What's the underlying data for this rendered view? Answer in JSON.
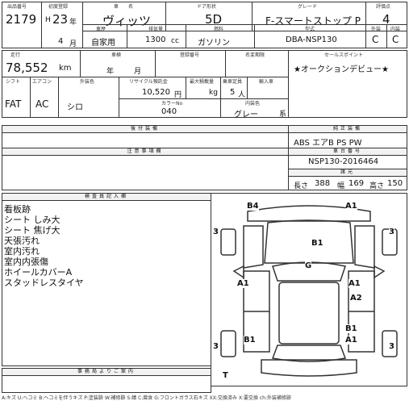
{
  "lot": {
    "header": "出品番号",
    "value": "2179"
  },
  "first_reg": {
    "header": "初度登録",
    "era": "H",
    "year": "23",
    "year_unit": "年",
    "month": "4",
    "month_unit": "月"
  },
  "car_name": {
    "header": "車　　名",
    "value": "ヴィッツ"
  },
  "door": {
    "header": "ドア形状",
    "value": "5D"
  },
  "grade": {
    "header": "グレード",
    "value": "F-スマートストップ P"
  },
  "score": {
    "header": "評価点",
    "value": "4"
  },
  "use": {
    "header": "車歴",
    "value": "自家用"
  },
  "displacement": {
    "header": "排気量",
    "value": "1300",
    "unit": "cc"
  },
  "fuel": {
    "header": "燃料",
    "value": "ガソリン"
  },
  "model": {
    "header": "型式",
    "value": "DBA-NSP130"
  },
  "ext_int": {
    "header_ext": "外装",
    "header_int": "内装",
    "ext": "C",
    "int": "C"
  },
  "mileage": {
    "header": "走行",
    "value": "78,552",
    "unit": "km"
  },
  "inspection": {
    "header": "車検",
    "year_unit": "年",
    "month_unit": "月"
  },
  "reg_number": {
    "header": "登録番号"
  },
  "name_change": {
    "header": "名変期限"
  },
  "sales_point": {
    "header": "セールスポイント",
    "value": "★オークションデビュー★"
  },
  "shift": {
    "header": "シフト",
    "value": "FAT"
  },
  "aircon": {
    "header": "エアコン",
    "value": "AC"
  },
  "color": {
    "header": "外装色",
    "value": "シロ"
  },
  "recycle": {
    "header": "リサイクル預託金",
    "value": "10,520",
    "unit": "円"
  },
  "max_load": {
    "header": "最大積載量",
    "unit": "kg"
  },
  "capacity": {
    "header": "乗車定員",
    "value": "5",
    "unit": "人"
  },
  "import": {
    "header": "輸入車"
  },
  "color_no": {
    "header": "カラーNo",
    "value": "040"
  },
  "int_color": {
    "header": "内装色",
    "value": "グレー",
    "unit": "系"
  },
  "aftermarket": {
    "header": "後付装備"
  },
  "equipment": {
    "header": "純正装備",
    "value": "ABS エアB PS PW"
  },
  "notes": {
    "header": "注意事項欄"
  },
  "chassis": {
    "header": "車台番号",
    "value": "NSP130-2016464"
  },
  "dims": {
    "header": "諸元",
    "length_label": "長さ",
    "length": "388",
    "width_label": "幅",
    "width": "169",
    "height_label": "高さ",
    "height": "150"
  },
  "inspector": {
    "header": "検査員記入欄",
    "lines": [
      "看板跡",
      "シート しみ大",
      "シート 焦げ大",
      "天張汚れ",
      "室内汚れ",
      "室内内張傷",
      "ホイールカバーA",
      "スタッドレスタイヤ"
    ]
  },
  "footer": {
    "header": "事務局よりご案内",
    "legend": "A:キズ U:ヘコミ B:ヘコミを伴うキズ P:塗装跡 W:補修跡 S:錆 C:腐食 G:フロントガラス石キズ XX:交換済み X:要交換 ch:外装補修跡"
  },
  "diagram": {
    "marks": [
      {
        "code": "B4"
      },
      {
        "code": "A1"
      },
      {
        "code": "3"
      },
      {
        "code": "3"
      },
      {
        "code": "B1"
      },
      {
        "code": "G"
      },
      {
        "code": "A1"
      },
      {
        "code": "A1"
      },
      {
        "code": "A2"
      },
      {
        "code": "3"
      },
      {
        "code": "3"
      },
      {
        "code": "B1"
      },
      {
        "code": "B1"
      },
      {
        "code": "A1"
      },
      {
        "code": "T"
      }
    ]
  }
}
